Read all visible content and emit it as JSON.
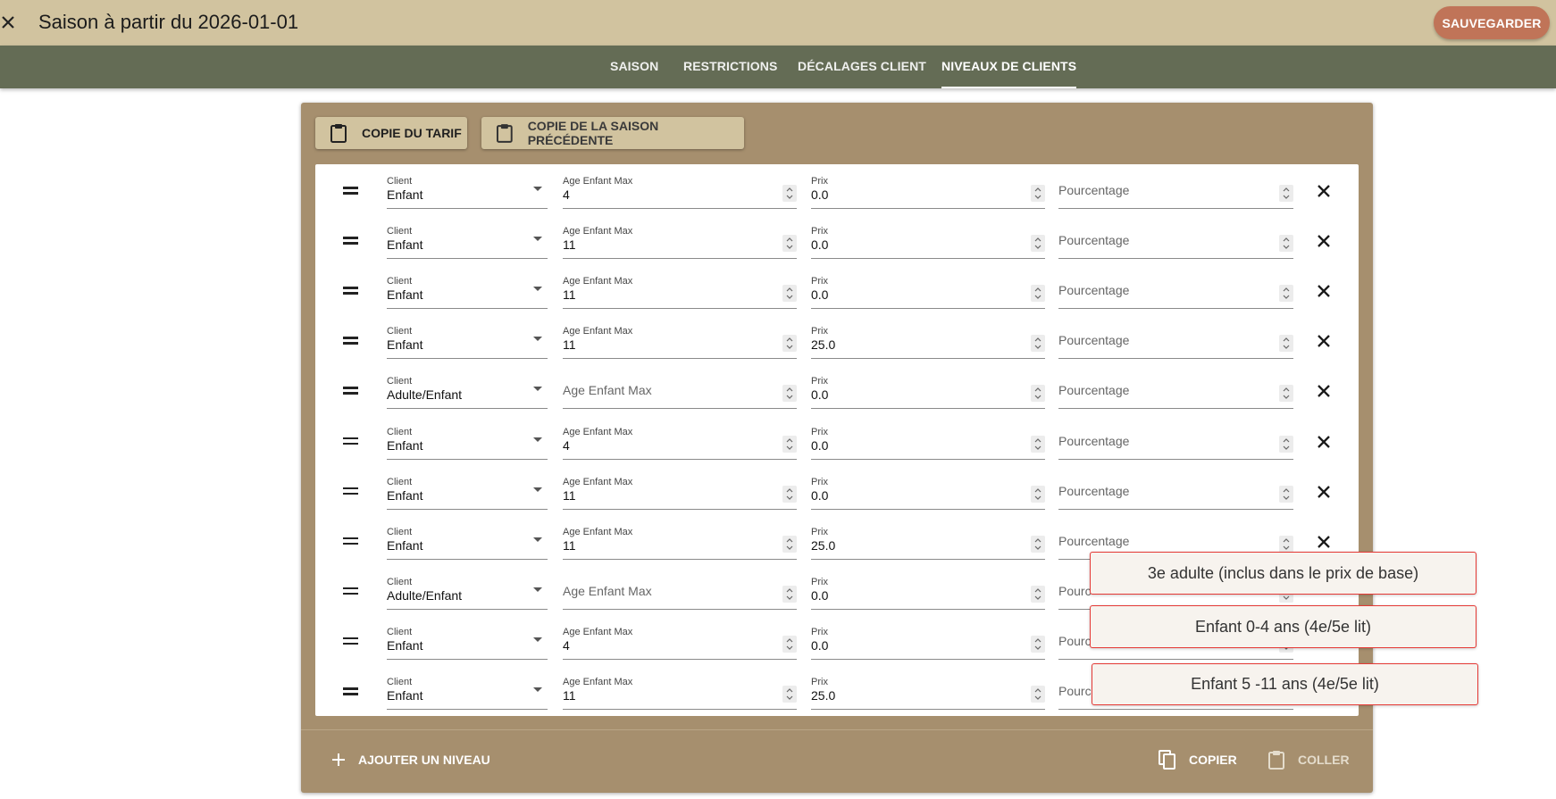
{
  "header": {
    "title": "Saison à partir du 2026-01-01",
    "save_label": "SAUVEGARDER"
  },
  "tabs": [
    {
      "label": "SAISON",
      "active": false
    },
    {
      "label": "RESTRICTIONS",
      "active": false
    },
    {
      "label": "DÉCALAGES CLIENT",
      "active": false
    },
    {
      "label": "NIVEAUX DE CLIENTS",
      "active": true
    }
  ],
  "toolbar": {
    "copy_tariff": "COPIE DU TARIF",
    "copy_previous": "COPIE DE LA SAISON PRÉCÉDENTE"
  },
  "field_labels": {
    "client": "Client",
    "age": "Age Enfant Max",
    "price": "Prix",
    "percent": "Pourcentage",
    "percent_truncated": "Pourc"
  },
  "rows": [
    {
      "client": "Enfant",
      "age": "4",
      "price": "0.0",
      "percent": ""
    },
    {
      "client": "Enfant",
      "age": "11",
      "price": "0.0",
      "percent": ""
    },
    {
      "client": "Enfant",
      "age": "11",
      "price": "0.0",
      "percent": ""
    },
    {
      "client": "Enfant",
      "age": "11",
      "price": "25.0",
      "percent": ""
    },
    {
      "client": "Adulte/Enfant",
      "age": "",
      "price": "0.0",
      "percent": ""
    },
    {
      "client": "Enfant",
      "age": "4",
      "price": "0.0",
      "percent": ""
    },
    {
      "client": "Enfant",
      "age": "11",
      "price": "0.0",
      "percent": ""
    },
    {
      "client": "Enfant",
      "age": "11",
      "price": "25.0",
      "percent": ""
    },
    {
      "client": "Adulte/Enfant",
      "age": "",
      "price": "0.0",
      "percent": ""
    },
    {
      "client": "Enfant",
      "age": "4",
      "price": "0.0",
      "percent": ""
    },
    {
      "client": "Enfant",
      "age": "11",
      "price": "25.0",
      "percent": ""
    }
  ],
  "footer": {
    "add_level": "AJOUTER UN NIVEAU",
    "copy": "COPIER",
    "paste": "COLLER"
  },
  "callouts": [
    "3e adulte (inclus dans le prix de base)",
    "Enfant 0-4 ans (4e/5e lit)",
    "Enfant 5 -11 ans (4e/5e lit)"
  ],
  "colors": {
    "header_bg": "#d1c39f",
    "tab_bg": "#646c55",
    "card_bg": "#a68f6e",
    "save_btn": "#c07458",
    "callout_border": "#e53935"
  }
}
